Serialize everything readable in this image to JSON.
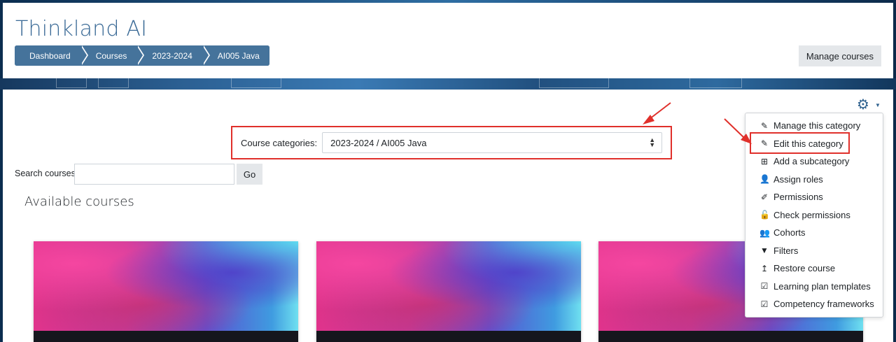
{
  "header": {
    "site_title": "Thinkland AI",
    "breadcrumbs": [
      "Dashboard",
      "Courses",
      "2023-2024",
      "AI005 Java"
    ],
    "manage_courses_label": "Manage courses"
  },
  "category_selector": {
    "label": "Course categories:",
    "selected_value": "2023-2024 / AI005 Java"
  },
  "search": {
    "label": "Search courses",
    "value": "",
    "go_label": "Go"
  },
  "available_courses_title": "Available courses",
  "settings_menu": {
    "icon": "gear-icon",
    "items": [
      {
        "label": "Manage this category",
        "icon": "pencil-icon"
      },
      {
        "label": "Edit this category",
        "icon": "pencil-icon"
      },
      {
        "label": "Add a subcategory",
        "icon": "plus-square-icon"
      },
      {
        "label": "Assign roles",
        "icon": "user-plus-icon"
      },
      {
        "label": "Permissions",
        "icon": "edit-square-icon"
      },
      {
        "label": "Check permissions",
        "icon": "unlock-icon"
      },
      {
        "label": "Cohorts",
        "icon": "users-icon"
      },
      {
        "label": "Filters",
        "icon": "filter-icon"
      },
      {
        "label": "Restore course",
        "icon": "level-up-icon"
      },
      {
        "label": "Learning plan templates",
        "icon": "check-square-icon"
      },
      {
        "label": "Competency frameworks",
        "icon": "check-square-icon"
      }
    ]
  },
  "annotation_color": "#e0302b",
  "brand_color": "#45739b"
}
